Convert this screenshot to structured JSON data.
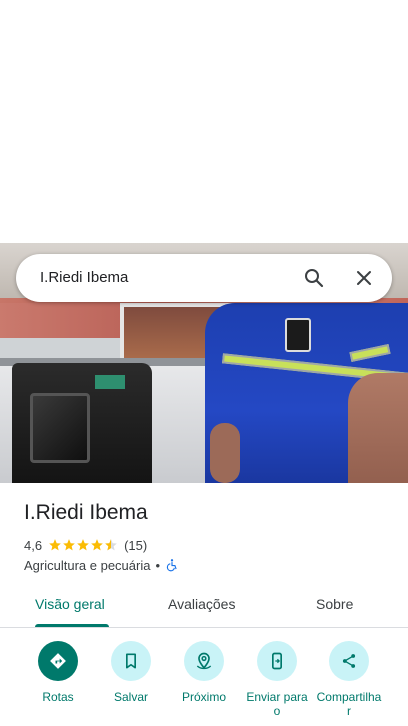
{
  "search": {
    "value": "I.Riedi Ibema"
  },
  "place": {
    "name": "I.Riedi Ibema",
    "rating": "4,6",
    "stars": 4.6,
    "review_count": "(15)",
    "category": "Agricultura e pecuária",
    "separator": "•"
  },
  "tabs": [
    {
      "label": "Visão geral",
      "active": true
    },
    {
      "label": "Avaliações",
      "active": false
    },
    {
      "label": "Sobre",
      "active": false
    }
  ],
  "actions": [
    {
      "label": "Rotas",
      "icon": "directions-icon"
    },
    {
      "label": "Salvar",
      "icon": "bookmark-icon"
    },
    {
      "label": "Próximo",
      "icon": "nearby-icon"
    },
    {
      "label": "Enviar para o",
      "icon": "send-to-phone-icon"
    },
    {
      "label": "Compartilha r",
      "icon": "share-icon"
    }
  ],
  "colors": {
    "accent": "#00796b",
    "accent_light": "#c9f3f7",
    "star": "#fbbc04",
    "accessibility": "#1a73e8"
  }
}
